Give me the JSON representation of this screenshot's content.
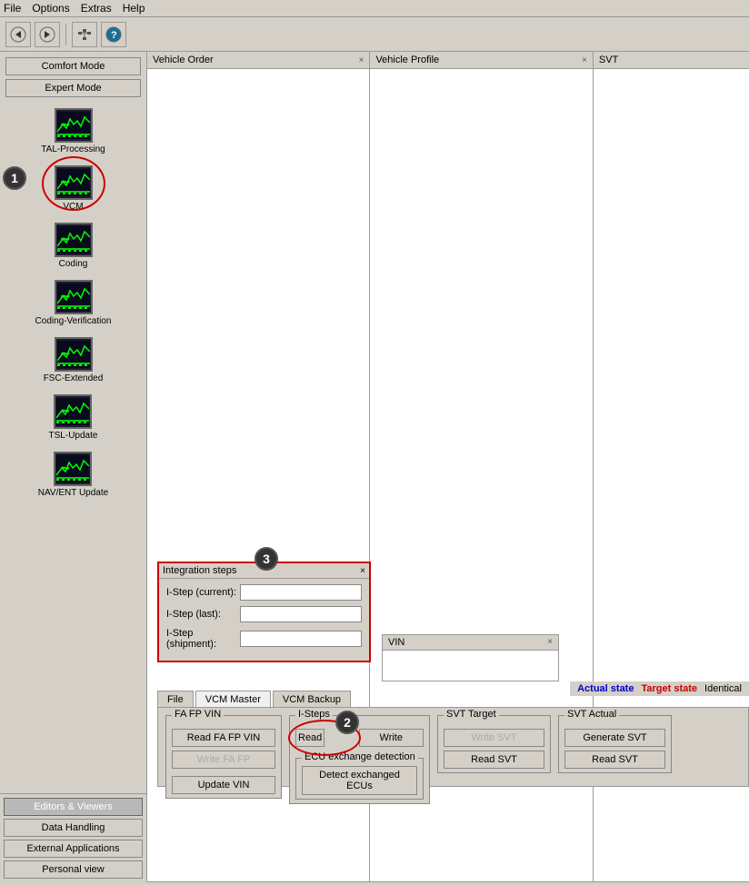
{
  "menu": {
    "items": [
      "File",
      "Options",
      "Extras",
      "Help"
    ]
  },
  "toolbar": {
    "buttons": [
      "back",
      "forward",
      "network",
      "help"
    ]
  },
  "sidebar": {
    "comfort_mode": "Comfort Mode",
    "expert_mode": "Expert Mode",
    "items": [
      {
        "id": "tal-processing",
        "label": "TAL-Processing"
      },
      {
        "id": "vcm",
        "label": "VCM"
      },
      {
        "id": "coding",
        "label": "Coding"
      },
      {
        "id": "coding-verification",
        "label": "Coding-Verification"
      },
      {
        "id": "fsc-extended",
        "label": "FSC-Extended"
      },
      {
        "id": "tsl-update",
        "label": "TSL-Update"
      },
      {
        "id": "nav-ent-update",
        "label": "NAV/ENT Update"
      }
    ],
    "bottom_buttons": [
      {
        "id": "editors-viewers",
        "label": "Editors & Viewers",
        "active": true
      },
      {
        "id": "data-handling",
        "label": "Data Handling"
      },
      {
        "id": "external-applications",
        "label": "External Applications"
      },
      {
        "id": "personal-view",
        "label": "Personal view"
      }
    ]
  },
  "panels": {
    "vehicle_order": {
      "label": "Vehicle Order",
      "closeable": true
    },
    "vehicle_profile": {
      "label": "Vehicle Profile",
      "closeable": true
    },
    "svt": {
      "label": "SVT",
      "closeable": false
    }
  },
  "integration_steps": {
    "title": "Integration steps",
    "close": "×",
    "fields": [
      {
        "label": "I-Step (current):",
        "value": ""
      },
      {
        "label": "I-Step (last):",
        "value": ""
      },
      {
        "label": "I-Step (shipment):",
        "value": ""
      }
    ]
  },
  "vin_panel": {
    "label": "VIN",
    "closeable": true
  },
  "state_bar": {
    "actual": "Actual state",
    "target": "Target state",
    "identical": "Identical"
  },
  "tabs": [
    "File",
    "VCM Master",
    "VCM Backup"
  ],
  "fa_fp_vin": {
    "group_label": "FA FP VIN",
    "read_btn": "Read FA FP VIN",
    "write_btn": "Write FA FP",
    "update_btn": "Update VIN"
  },
  "i_steps": {
    "group_label": "I-Steps",
    "read_btn": "Read",
    "write_btn": "Write"
  },
  "ecu_exchange": {
    "label": "ECU exchange detection",
    "detect_btn": "Detect exchanged ECUs"
  },
  "svt_target": {
    "group_label": "SVT Target",
    "write_btn": "Write SVT",
    "read_btn": "Read SVT"
  },
  "svt_actual": {
    "group_label": "SVT Actual",
    "generate_btn": "Generate SVT",
    "read_btn": "Read SVT"
  },
  "badges": {
    "1": "①",
    "2": "②",
    "3": "③"
  }
}
